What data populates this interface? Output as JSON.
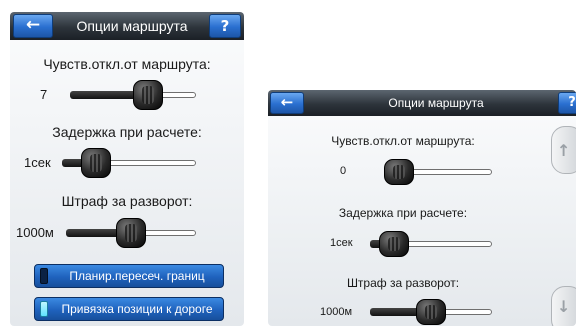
{
  "panel_a": {
    "header": {
      "back_icon": "arrow-left-icon",
      "back_glyph": "←",
      "title": "Опции маршрута",
      "help_label": "?"
    },
    "settings": [
      {
        "label": "Чувств.откл.от маршрута:",
        "value": "7",
        "level": 0.66
      },
      {
        "label": "Задержка при расчете:",
        "value": "1сек",
        "level": 0.18
      },
      {
        "label": "Штраф за разворот:",
        "value": "1000м",
        "level": 0.5
      }
    ],
    "toggles": [
      {
        "label": "Планир.пересеч. границ",
        "checked": false
      },
      {
        "label": "Привязка позиции к дороге",
        "checked": true
      }
    ]
  },
  "panel_b": {
    "header": {
      "back_icon": "arrow-left-icon",
      "back_glyph": "←",
      "title": "Опции маршрута",
      "help_label": "?"
    },
    "settings": [
      {
        "label": "Чувств.откл.от маршрута:",
        "value": "0",
        "level": 0.0
      },
      {
        "label": "Задержка при расчете:",
        "value": "1сек",
        "level": 0.1
      },
      {
        "label": "Штраф за разворот:",
        "value": "1000м",
        "level": 0.5
      }
    ],
    "scroll_up": {
      "icon": "scroll-up-arrow-icon",
      "glyph": "↑"
    },
    "scroll_down": {
      "icon": "scroll-down-arrow-icon",
      "glyph": "↓"
    }
  },
  "colors": {
    "accent_blue": "#2a6fd0",
    "header_dark": "#2d343b",
    "indicator_on": "#5fe2ff"
  }
}
